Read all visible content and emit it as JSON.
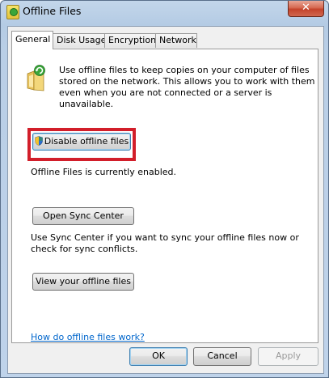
{
  "window": {
    "title": "Offline Files",
    "close_label": "✕"
  },
  "tabs": [
    {
      "label": "General",
      "active": true
    },
    {
      "label": "Disk Usage",
      "active": false
    },
    {
      "label": "Encryption",
      "active": false
    },
    {
      "label": "Network",
      "active": false
    }
  ],
  "general": {
    "icon": "offline-folder-sync-icon",
    "description": "Use offline files to keep copies on your computer of files stored on the network.  This allows you to work with them even when you are not connected or a server is unavailable.",
    "disable_button": "Disable offline files",
    "disable_button_icon": "uac-shield-icon",
    "status": "Offline Files is currently enabled.",
    "open_sync_button": "Open Sync Center",
    "sync_description": "Use Sync Center if you want to sync your offline files now or check for sync conflicts.",
    "view_button": "View your offline files",
    "help_link": "How do offline files work?"
  },
  "footer": {
    "ok": "OK",
    "cancel": "Cancel",
    "apply": "Apply"
  },
  "colors": {
    "highlight_box": "#d21e2a",
    "link": "#0066cc"
  }
}
